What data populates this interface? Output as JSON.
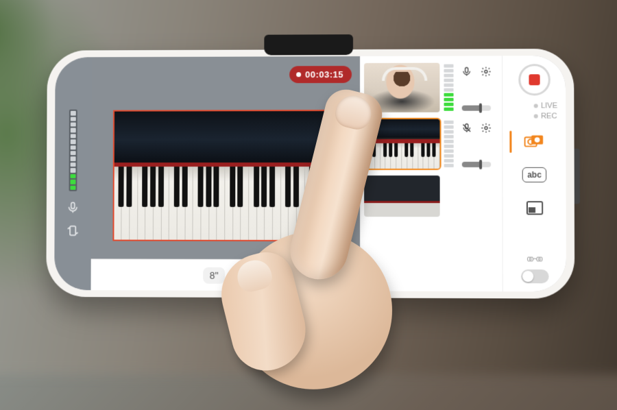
{
  "recording": {
    "elapsed": "00:03:15"
  },
  "modes": {
    "live_label": "LIVE",
    "rec_label": "REC"
  },
  "bottom": {
    "chip_value": "8\""
  },
  "right_tabs": {
    "text_button_label": "abc"
  },
  "sources": [
    {
      "id": "front-cam",
      "mic_enabled": true,
      "selected": false
    },
    {
      "id": "back-cam",
      "mic_enabled": false,
      "selected": true
    },
    {
      "id": "wide-cam",
      "mic_enabled": false,
      "selected": false
    }
  ],
  "colors": {
    "accent": "#f2861e",
    "record": "#e0392e",
    "rec_pill": "#b02a2a",
    "vu_on": "#3ddc3d"
  }
}
